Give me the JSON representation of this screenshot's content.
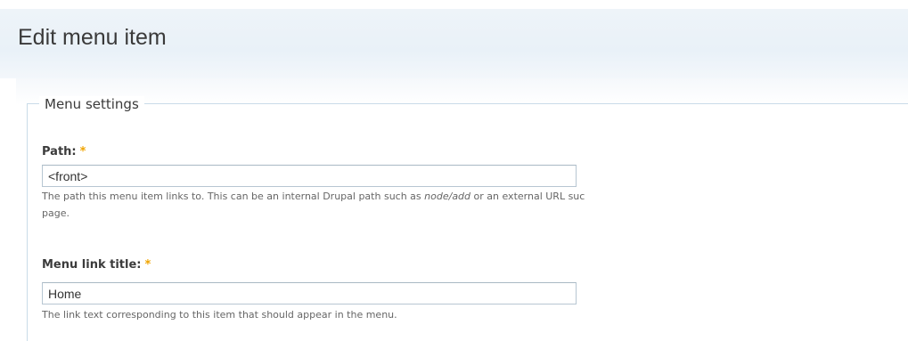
{
  "page": {
    "title": "Edit menu item"
  },
  "menu_settings": {
    "legend": "Menu settings",
    "required_marker": "*",
    "path": {
      "label": "Path:",
      "value": "<front>",
      "description_part1": "The path this menu item links to. This can be an internal Drupal path such as ",
      "description_em1": "node/add",
      "description_part2": " or an external URL suc",
      "description_line2": "page."
    },
    "link_title": {
      "label": "Menu link title:",
      "value": "Home",
      "description": "The link text corresponding to this item that should appear in the menu."
    }
  }
}
